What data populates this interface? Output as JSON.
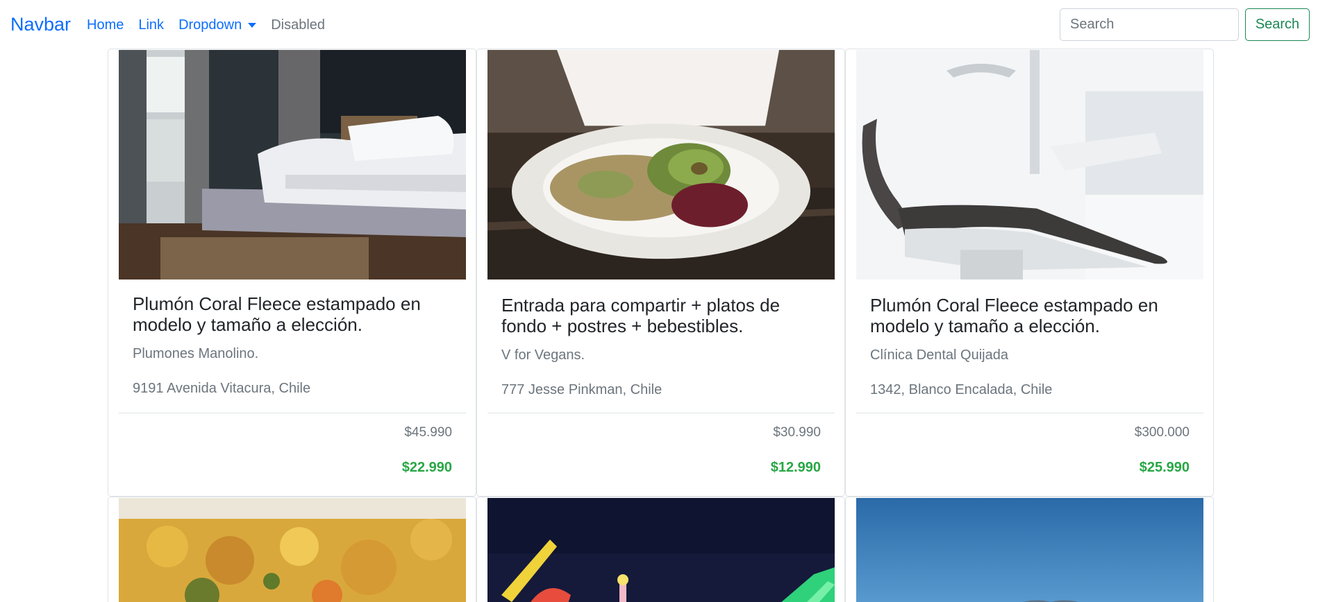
{
  "navbar": {
    "brand": "Navbar",
    "links": [
      {
        "label": "Home"
      },
      {
        "label": "Link"
      },
      {
        "label": "Dropdown"
      },
      {
        "label": "Disabled"
      }
    ],
    "search": {
      "placeholder": "Search",
      "button_label": "Search"
    }
  },
  "colors": {
    "primary": "#0d6efd",
    "success": "#198754",
    "price_green": "#28a745",
    "muted": "#6c757d"
  },
  "cards": [
    {
      "image": "bedroom-bed-photo",
      "title": "Plumón Coral Fleece estampado en modelo y tamaño a elección.",
      "vendor": "Plumones Manolino.",
      "address": "9191 Avenida Vitacura, Chile",
      "old_price": "$45.990",
      "new_price": "$22.990"
    },
    {
      "image": "vegan-salad-plate-photo",
      "title": "Entrada para compartir + platos de fondo + postres + bebestibles.",
      "vendor": "V for Vegans.",
      "address": "777 Jesse Pinkman, Chile",
      "old_price": "$30.990",
      "new_price": "$12.990"
    },
    {
      "image": "dental-chair-photo",
      "title": "Plumón Coral Fleece estampado en modelo y tamaño a elección.",
      "vendor": "Clínica Dental Quijada",
      "address": "1342, Blanco Encalada, Chile",
      "old_price": "$300.000",
      "new_price": "$25.990"
    },
    {
      "image": "scrambled-food-photo"
    },
    {
      "image": "night-fair-lights-photo"
    },
    {
      "image": "sky-landscape-photo"
    }
  ]
}
